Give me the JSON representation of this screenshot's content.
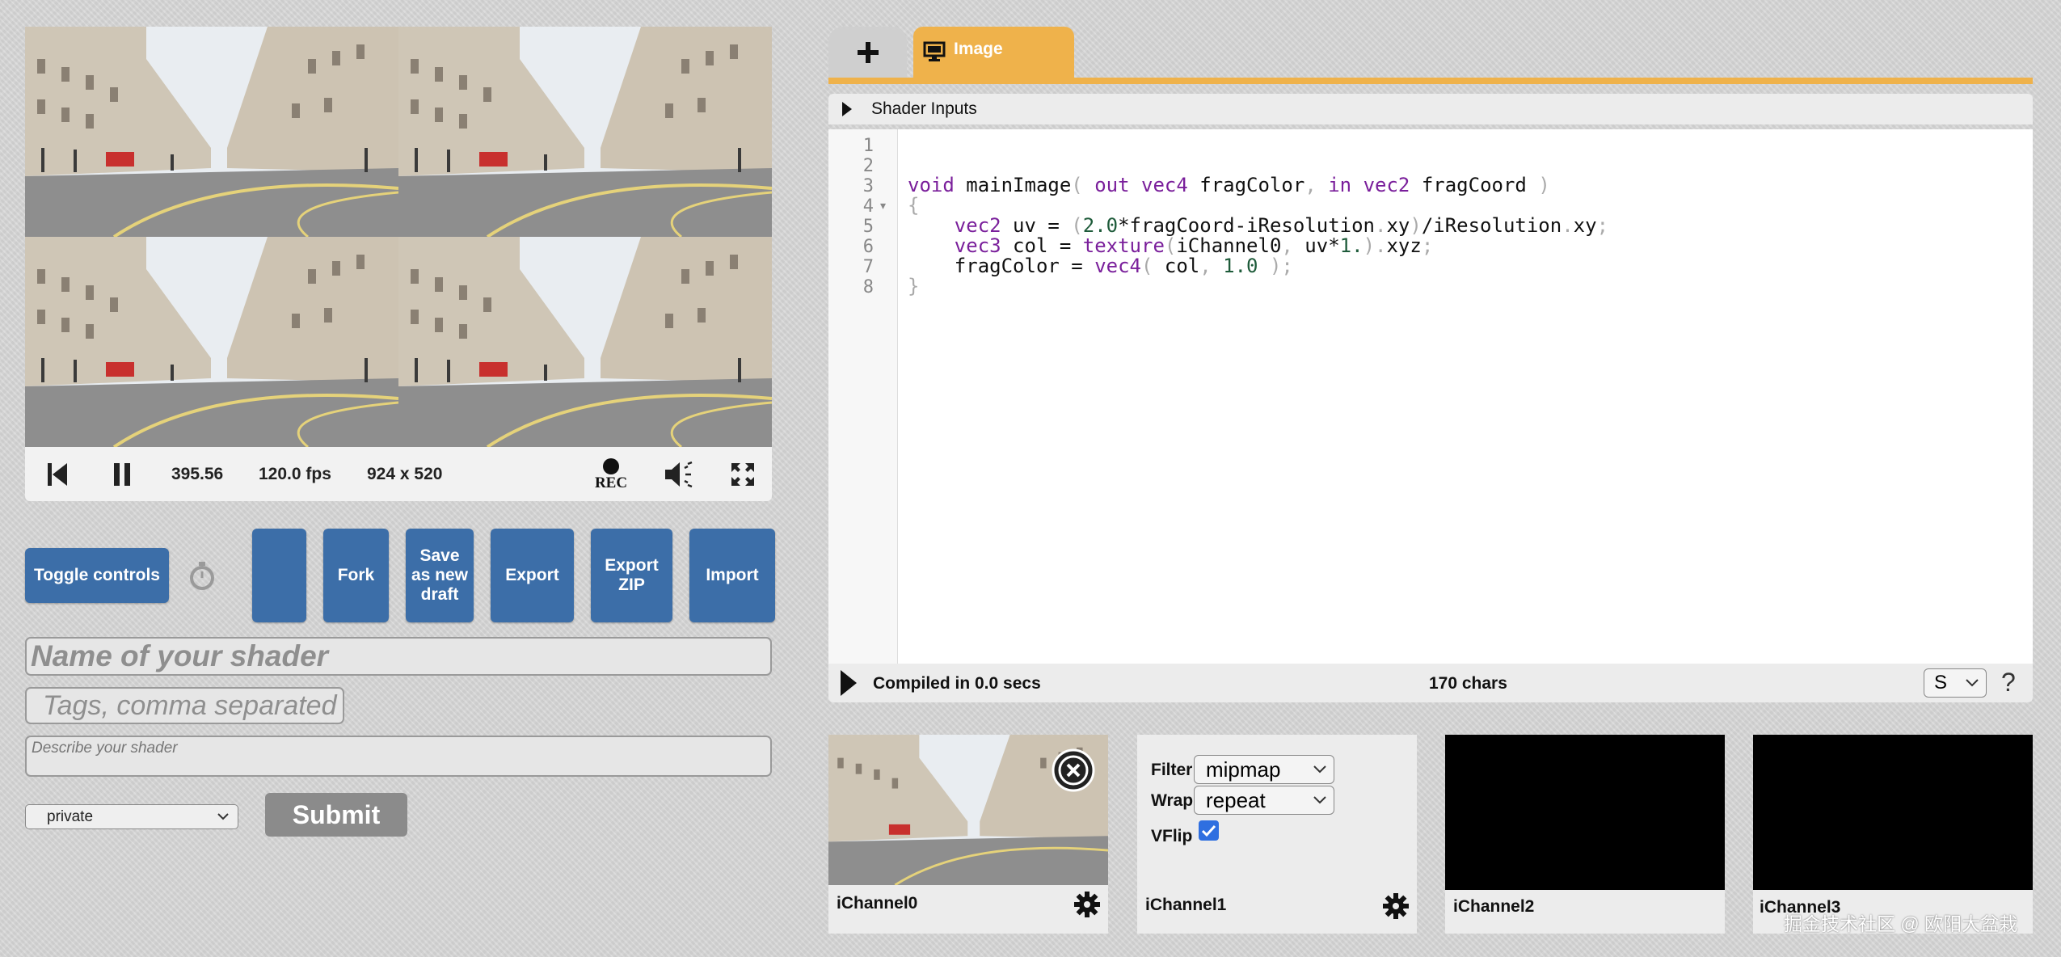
{
  "viewer": {
    "time": "395.56",
    "fps": "120.0 fps",
    "resolution": "924 x 520",
    "rec_label": "REC"
  },
  "controls": {
    "toggle_label": "Toggle controls",
    "fork_label": "Fork",
    "save_draft_label": "Save as new draft",
    "export_label": "Export",
    "export_zip_label": "Export ZIP",
    "import_label": "Import"
  },
  "meta": {
    "name_placeholder": "Name of your shader",
    "tags_placeholder": "Tags, comma separated",
    "description_placeholder": "Describe your shader",
    "visibility": "private",
    "submit_label": "Submit"
  },
  "editor": {
    "tab_label": "Image",
    "inputs_label": "Shader Inputs",
    "line_numbers": [
      "1",
      "2",
      "3",
      "4",
      "5",
      "6",
      "7",
      "8"
    ],
    "compiled_text": "Compiled in 0.0 secs",
    "chars_text": "170 chars",
    "font_size_option": "S",
    "help_label": "?"
  },
  "channels": {
    "ch0_label": "iChannel0",
    "ch1_label": "iChannel1",
    "ch2_label": "iChannel2",
    "ch3_label": "iChannel3",
    "filter_label": "Filter",
    "filter_value": "mipmap",
    "wrap_label": "Wrap",
    "wrap_value": "repeat",
    "vflip_label": "VFlip"
  },
  "watermark": "掘金技术社区 @ 欧阳大盆栽",
  "colors": {
    "accent_tab": "#efb24b",
    "button_blue": "#3c6ea8",
    "keyword": "#7a1f9b"
  }
}
